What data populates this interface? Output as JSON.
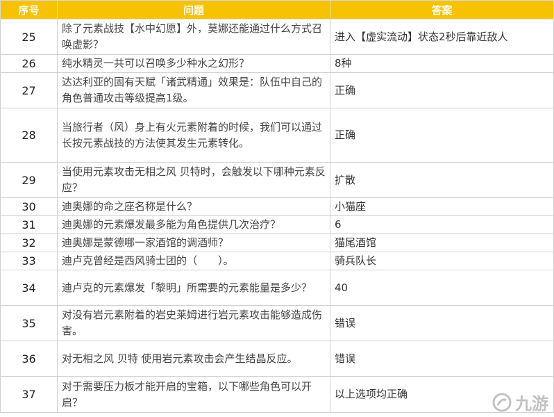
{
  "header": {
    "col_no": "序号",
    "col_question": "问题",
    "col_answer": "答案"
  },
  "rows": [
    {
      "no": "25",
      "question": "除了元素战技【水中幻愿】外，莫娜还能通过什么方式召唤虚影？",
      "answer": "进入【虚实流动】状态2秒后靠近敌人",
      "h": 51
    },
    {
      "no": "26",
      "question": "纯水精灵一共可以召唤多少种水之幻形？",
      "answer": "8种",
      "h": 26
    },
    {
      "no": "27",
      "question": "达达利亚的固有天赋「诸武精通」效果是：队伍中自己的角色普通攻击等级提高1级。",
      "answer": "正确",
      "h": 51
    },
    {
      "no": "28",
      "question": "当旅行者（风）身上有火元素附着的时候，我们可以通过长按元素战技的方法使其发生元素转化。",
      "answer": "正确",
      "h": 78
    },
    {
      "no": "29",
      "question": "当使用元素攻击无相之风 贝特时，会触发以下哪种元素反应？",
      "answer": "扩散",
      "h": 51
    },
    {
      "no": "30",
      "question": "迪奥娜的命之座名称是什么？",
      "answer": "小猫座",
      "h": 26
    },
    {
      "no": "31",
      "question": "迪奥娜的元素爆发最多能为角色提供几次治疗？",
      "answer": "6",
      "h": 26
    },
    {
      "no": "32",
      "question": "迪奥娜是蒙德哪一家酒馆的调酒师？",
      "answer": "猫尾酒馆",
      "h": 26
    },
    {
      "no": "33",
      "question": "迪卢克曾经是西风骑士团的（　　）。",
      "answer": "骑兵队长",
      "h": 26
    },
    {
      "no": "34",
      "question": "迪卢克的元素爆发「黎明」所需要的元素能量是多少？",
      "answer": "40",
      "h": 51
    },
    {
      "no": "35",
      "question": "对没有岩元素附着的岩史莱姆进行岩元素攻击能够造成伤害。",
      "answer": "错误",
      "h": 51
    },
    {
      "no": "36",
      "question": "对无相之风 贝特 使用岩元素攻击会产生结晶反应。",
      "answer": "错误",
      "h": 51
    },
    {
      "no": "37",
      "question": "对于需要压力板才能开启的宝箱，以下哪些角色可以开启？",
      "answer": "以上选项均正确",
      "h": 52
    }
  ],
  "watermark": {
    "text": "九游",
    "icon": "jiuyou-logo-icon"
  },
  "colors": {
    "header_bg": "#f7c200",
    "header_text": "#ffffff",
    "border": "#d0d0d0"
  }
}
